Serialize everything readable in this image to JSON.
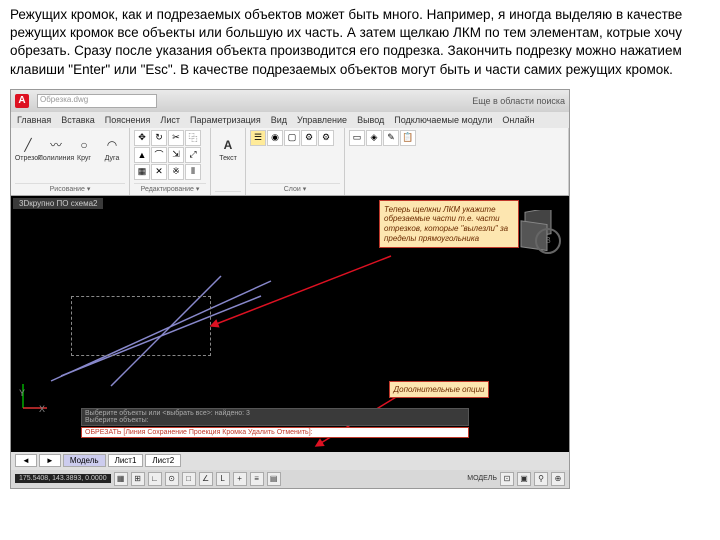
{
  "description": "Режущих кромок, как и подрезаемых объектов может быть много. Например, я иногда выделяю в качестве режущих кромок все объекты или большую их часть. А затем щелкаю ЛКМ по тем элементам, котрые хочу обрезать. Сразу после указания объекта производится его подрезка. Закончить подрезку можно нажатием клавиши \"Enter\" или \"Esc\". В качестве подрезаемых объектов могут быть и части самих режущих кромок.",
  "title_field": "Обрезка.dwg",
  "title_suffix": "Еще в области поиска",
  "menu": [
    "Главная",
    "Вставка",
    "Пояснения",
    "Лист",
    "Параметризация",
    "Вид",
    "Управление",
    "Вывод",
    "Подключаемые модули",
    "Онлайн"
  ],
  "ribbon": {
    "g1": {
      "items": [
        "Отрезок",
        "Полилиния",
        "Круг",
        "Дуга"
      ],
      "label": "Рисование ▾"
    },
    "g2": {
      "label": "Редактирование ▾"
    },
    "g3": {
      "items": [
        "A",
        "Текст"
      ],
      "label": ""
    },
    "g4": {
      "label": "Слои ▾"
    }
  },
  "viewport_tab": "3Dкрупно ПО схема2",
  "note1": "Теперь щелкни ЛКМ укажите обрезаемые части т.е. части отрезков, которые \"вылезли\" за пределы прямоугольника",
  "note2": "Дополнительные опции",
  "cmdline1": "Выберите объекты или <выбрать все>: найдено: 3",
  "cmdline1b": "Выберите объекты:",
  "cmdline2": "ОБРЕЗАТЬ [Линия Сохранение Проекция Кромка Удалить Отменить]:",
  "tabs": [
    "◄",
    "►",
    "Модель",
    "Лист1",
    "Лист2"
  ],
  "coord": "175.5408, 143.3893, 0.0000",
  "status_right": "МОДЕЛЬ",
  "nav_label": "В"
}
